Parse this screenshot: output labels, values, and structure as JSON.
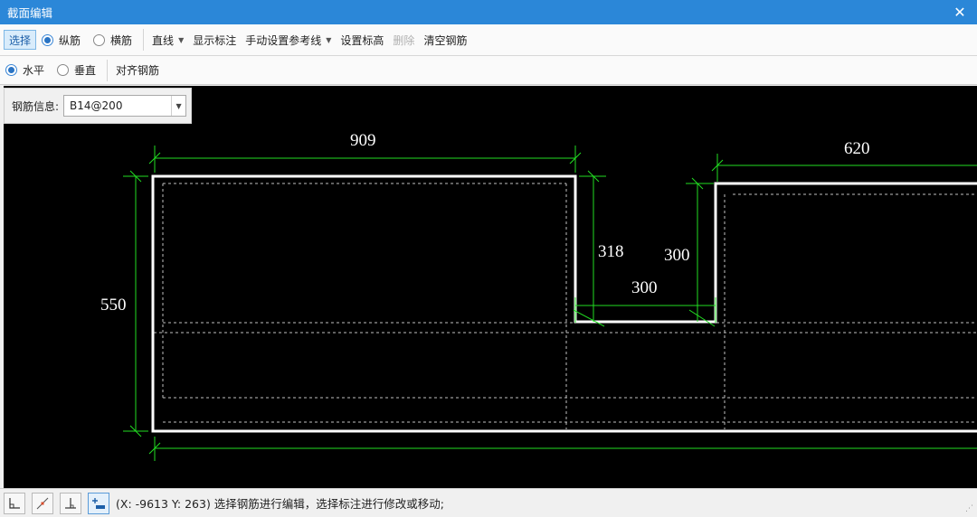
{
  "window": {
    "title": "截面编辑"
  },
  "toolbar1": {
    "select": "选择",
    "radio_longitudinal": "纵筋",
    "radio_transverse": "横筋",
    "line": "直线",
    "show_labels": "显示标注",
    "manual_ref_line": "手动设置参考线",
    "set_elevation": "设置标高",
    "delete": "删除",
    "clear_rebar": "清空钢筋"
  },
  "toolbar2": {
    "radio_horizontal": "水平",
    "radio_vertical": "垂直",
    "align_rebar": "对齐钢筋"
  },
  "info": {
    "label": "钢筋信息:",
    "value": "B14@200"
  },
  "dimensions": {
    "d909": "909",
    "d620": "620",
    "d550": "550",
    "d318": "318",
    "d300_right": "300",
    "d300_bottom": "300"
  },
  "colors": {
    "title_bar": "#2b87d8",
    "dim_line": "#22dd22",
    "outline": "#ffffff",
    "canvas": "#000000"
  },
  "statusbar": {
    "icons": [
      "ortho-icon",
      "snap-point-icon",
      "perpendicular-icon",
      "add-label-icon"
    ],
    "text": "(X: -9613 Y: 263)  选择钢筋进行编辑，选择标注进行修改或移动;"
  }
}
